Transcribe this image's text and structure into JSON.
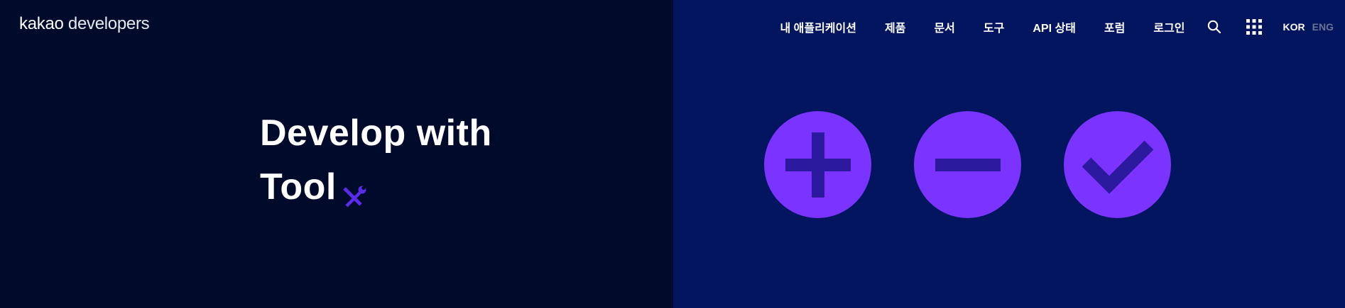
{
  "header": {
    "logo_brand": "kakao",
    "logo_product": "developers",
    "nav_items": [
      {
        "label": "내 애플리케이션"
      },
      {
        "label": "제품"
      },
      {
        "label": "문서"
      },
      {
        "label": "도구"
      },
      {
        "label": "API 상태"
      },
      {
        "label": "포럼"
      },
      {
        "label": "로그인"
      }
    ],
    "icons": {
      "search": "search-icon",
      "apps": "grid-icon"
    },
    "languages": {
      "active": "KOR",
      "inactive": "ENG"
    }
  },
  "hero": {
    "line1": "Develop with",
    "line2": "Tool",
    "icon": "wrench-screwdriver-icon"
  },
  "illustration": {
    "icons": [
      "plus-icon",
      "minus-icon",
      "check-icon"
    ]
  },
  "colors": {
    "left_background": "#000a2a",
    "right_background": "#02155e",
    "accent_purple": "#7b34ff",
    "icon_dark_purple": "#2b1a9e",
    "lang_inactive": "#6a7596"
  }
}
